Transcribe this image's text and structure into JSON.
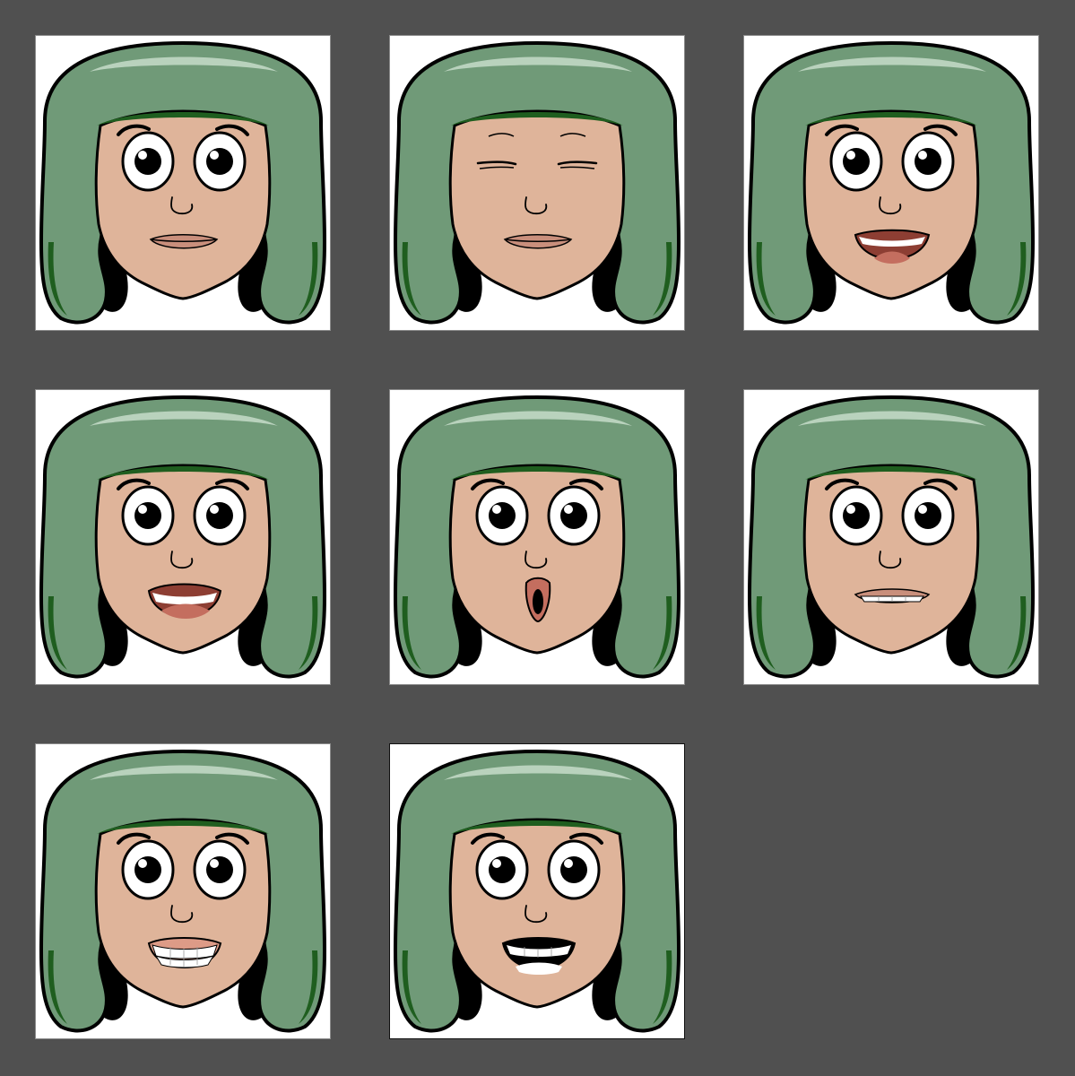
{
  "colors": {
    "background": "#505050",
    "tile": "#ffffff",
    "hair": "#709a78",
    "hair_highlight": "#b9d2bd",
    "hair_shadow": "#1f5e1f",
    "skin": "#dfb49a",
    "outline": "#000000",
    "lips": "#c98f7c",
    "mouth_inner": "#8d3e33",
    "tongue": "#c46e5f"
  },
  "tiles": [
    {
      "eyes": "open-icon",
      "mouth": "closed-lips-icon"
    },
    {
      "eyes": "closed-icon",
      "mouth": "closed-lips-icon"
    },
    {
      "eyes": "open-icon",
      "mouth": "open-smile-icon"
    },
    {
      "eyes": "open-icon",
      "mouth": "wide-open-smile-icon"
    },
    {
      "eyes": "open-icon",
      "mouth": "o-shape-icon"
    },
    {
      "eyes": "open-icon",
      "mouth": "teeth-clenched-icon"
    },
    {
      "eyes": "open-icon",
      "mouth": "toothy-grin-icon"
    },
    {
      "eyes": "open-icon",
      "mouth": "open-teeth-icon"
    }
  ]
}
